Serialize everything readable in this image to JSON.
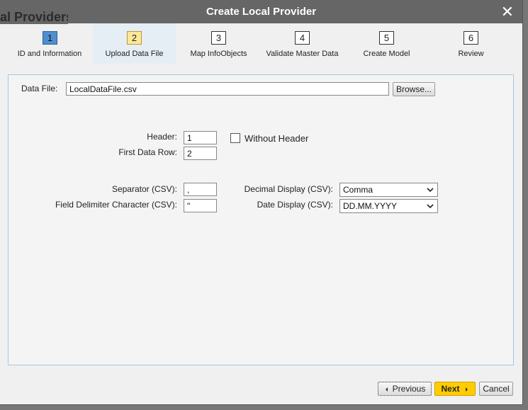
{
  "background": {
    "title": "al Providers"
  },
  "dialog": {
    "title": "Create Local Provider",
    "close_icon": "close-icon"
  },
  "steps": [
    {
      "num": "1",
      "label": "ID and Information"
    },
    {
      "num": "2",
      "label": "Upload Data File"
    },
    {
      "num": "3",
      "label": "Map InfoObjects"
    },
    {
      "num": "4",
      "label": "Validate Master Data"
    },
    {
      "num": "5",
      "label": "Create Model"
    },
    {
      "num": "6",
      "label": "Review"
    }
  ],
  "form": {
    "data_file_label": "Data File:",
    "data_file_value": "LocalDataFile.csv",
    "browse_label": "Browse...",
    "header_label": "Header:",
    "header_value": "1",
    "without_header_label": "Without Header",
    "first_row_label": "First Data Row:",
    "first_row_value": "2",
    "separator_label": "Separator (CSV):",
    "separator_value": ",",
    "delimiter_label": "Field Delimiter Character (CSV):",
    "delimiter_value": "\"",
    "decimal_label": "Decimal Display (CSV):",
    "decimal_value": "Comma",
    "date_label": "Date Display (CSV):",
    "date_value": "DD.MM.YYYY"
  },
  "footer": {
    "previous": "Previous",
    "next": "Next",
    "cancel": "Cancel"
  },
  "colors": {
    "next_button": "#ffcc00",
    "titlebar": "#666666",
    "step_done": "#4f8fd0",
    "step_active": "#ffe79a"
  }
}
